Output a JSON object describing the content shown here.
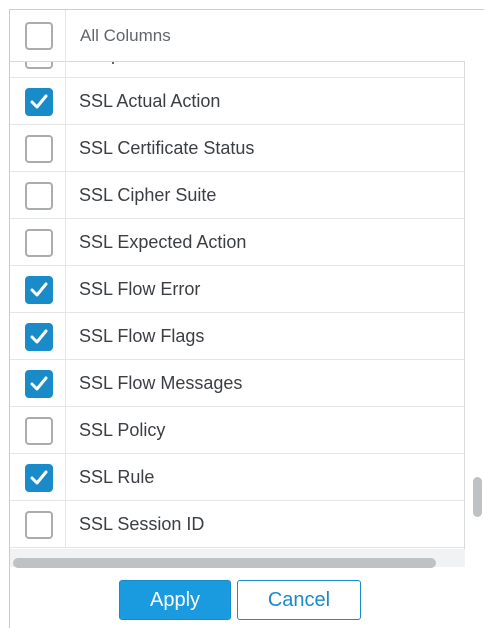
{
  "header": {
    "label": "All Columns",
    "checked": false
  },
  "rows": [
    {
      "label": "Responder Sentiment",
      "checked": false
    },
    {
      "label": "SSL Actual Action",
      "checked": true
    },
    {
      "label": "SSL Certificate Status",
      "checked": false
    },
    {
      "label": "SSL Cipher Suite",
      "checked": false
    },
    {
      "label": "SSL Expected Action",
      "checked": false
    },
    {
      "label": "SSL Flow Error",
      "checked": true
    },
    {
      "label": "SSL Flow Flags",
      "checked": true
    },
    {
      "label": "SSL Flow Messages",
      "checked": true
    },
    {
      "label": "SSL Policy",
      "checked": false
    },
    {
      "label": "SSL Rule",
      "checked": true
    },
    {
      "label": "SSL Session ID",
      "checked": false
    }
  ],
  "buttons": {
    "apply": "Apply",
    "cancel": "Cancel"
  },
  "colors": {
    "accent": "#1a8bc9",
    "apply_bg": "#1a9be0"
  }
}
